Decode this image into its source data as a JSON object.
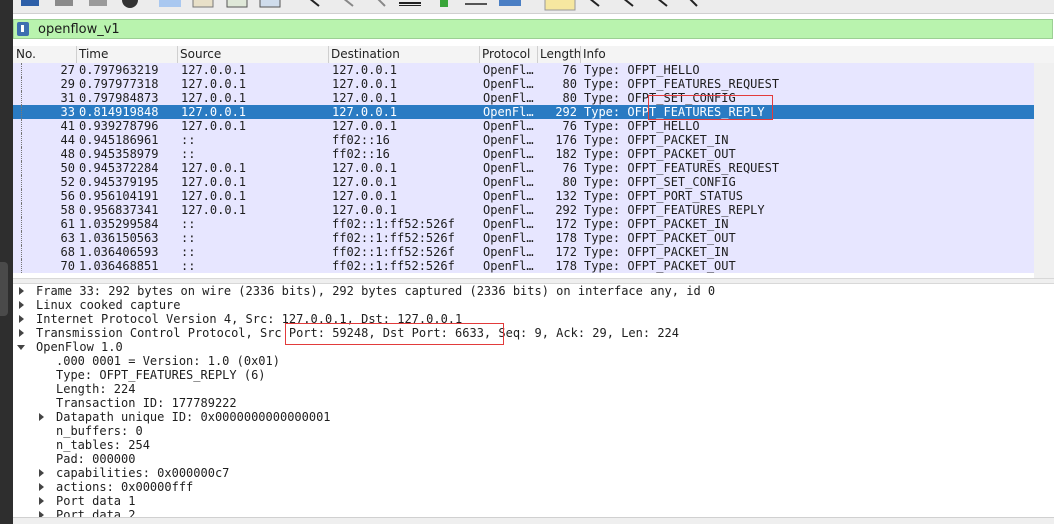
{
  "filter": {
    "value": "openflow_v1"
  },
  "columns": [
    "No.",
    "Time",
    "Source",
    "Destination",
    "Protocol",
    "Length",
    "Info"
  ],
  "packets": [
    {
      "no": "27",
      "time": "0.797963219",
      "src": "127.0.0.1",
      "dst": "127.0.0.1",
      "proto": "OpenFl…",
      "len": "76",
      "info": "Type: OFPT_HELLO"
    },
    {
      "no": "29",
      "time": "0.797977318",
      "src": "127.0.0.1",
      "dst": "127.0.0.1",
      "proto": "OpenFl…",
      "len": "80",
      "info": "Type: OFPT_FEATURES_REQUEST"
    },
    {
      "no": "31",
      "time": "0.797984873",
      "src": "127.0.0.1",
      "dst": "127.0.0.1",
      "proto": "OpenFl…",
      "len": "80",
      "info": "Type: OFPT_SET_CONFIG"
    },
    {
      "no": "33",
      "time": "0.814919848",
      "src": "127.0.0.1",
      "dst": "127.0.0.1",
      "proto": "OpenFl…",
      "len": "292",
      "info": "Type: OFPT_FEATURES_REPLY",
      "selected": true
    },
    {
      "no": "41",
      "time": "0.939278796",
      "src": "127.0.0.1",
      "dst": "127.0.0.1",
      "proto": "OpenFl…",
      "len": "76",
      "info": "Type: OFPT_HELLO"
    },
    {
      "no": "44",
      "time": "0.945186961",
      "src": "::",
      "dst": "ff02::16",
      "proto": "OpenFl…",
      "len": "176",
      "info": "Type: OFPT_PACKET_IN"
    },
    {
      "no": "48",
      "time": "0.945358979",
      "src": "::",
      "dst": "ff02::16",
      "proto": "OpenFl…",
      "len": "182",
      "info": "Type: OFPT_PACKET_OUT"
    },
    {
      "no": "50",
      "time": "0.945372284",
      "src": "127.0.0.1",
      "dst": "127.0.0.1",
      "proto": "OpenFl…",
      "len": "76",
      "info": "Type: OFPT_FEATURES_REQUEST"
    },
    {
      "no": "52",
      "time": "0.945379195",
      "src": "127.0.0.1",
      "dst": "127.0.0.1",
      "proto": "OpenFl…",
      "len": "80",
      "info": "Type: OFPT_SET_CONFIG"
    },
    {
      "no": "56",
      "time": "0.956104191",
      "src": "127.0.0.1",
      "dst": "127.0.0.1",
      "proto": "OpenFl…",
      "len": "132",
      "info": "Type: OFPT_PORT_STATUS"
    },
    {
      "no": "58",
      "time": "0.956837341",
      "src": "127.0.0.1",
      "dst": "127.0.0.1",
      "proto": "OpenFl…",
      "len": "292",
      "info": "Type: OFPT_FEATURES_REPLY"
    },
    {
      "no": "61",
      "time": "1.035299584",
      "src": "::",
      "dst": "ff02::1:ff52:526f",
      "proto": "OpenFl…",
      "len": "172",
      "info": "Type: OFPT_PACKET_IN"
    },
    {
      "no": "63",
      "time": "1.036150563",
      "src": "::",
      "dst": "ff02::1:ff52:526f",
      "proto": "OpenFl…",
      "len": "178",
      "info": "Type: OFPT_PACKET_OUT"
    },
    {
      "no": "68",
      "time": "1.036406593",
      "src": "::",
      "dst": "ff02::1:ff52:526f",
      "proto": "OpenFl…",
      "len": "172",
      "info": "Type: OFPT_PACKET_IN"
    },
    {
      "no": "70",
      "time": "1.036468851",
      "src": "::",
      "dst": "ff02::1:ff52:526f",
      "proto": "OpenFl…",
      "len": "178",
      "info": "Type: OFPT_PACKET_OUT"
    }
  ],
  "details": [
    {
      "text": "Frame 33: 292 bytes on wire (2336 bits), 292 bytes captured (2336 bits) on interface any, id 0",
      "arrow": "right",
      "indent": 0
    },
    {
      "text": "Linux cooked capture",
      "arrow": "right",
      "indent": 0
    },
    {
      "text": "Internet Protocol Version 4, Src: 127.0.0.1, Dst: 127.0.0.1",
      "arrow": "right",
      "indent": 0
    },
    {
      "text": "Transmission Control Protocol, Src Port: 59248, Dst Port: 6633, Seq: 9, Ack: 29, Len: 224",
      "arrow": "right",
      "indent": 0
    },
    {
      "text": "OpenFlow 1.0",
      "arrow": "down",
      "indent": 0
    },
    {
      "text": ".000 0001 = Version: 1.0 (0x01)",
      "arrow": "none",
      "indent": 1
    },
    {
      "text": "Type: OFPT_FEATURES_REPLY (6)",
      "arrow": "none",
      "indent": 1
    },
    {
      "text": "Length: 224",
      "arrow": "none",
      "indent": 1
    },
    {
      "text": "Transaction ID: 177789222",
      "arrow": "none",
      "indent": 1
    },
    {
      "text": "Datapath unique ID: 0x0000000000000001",
      "arrow": "right",
      "indent": 1
    },
    {
      "text": "n_buffers: 0",
      "arrow": "none",
      "indent": 1
    },
    {
      "text": "n_tables: 254",
      "arrow": "none",
      "indent": 1
    },
    {
      "text": "Pad: 000000",
      "arrow": "none",
      "indent": 1
    },
    {
      "text": "capabilities: 0x000000c7",
      "arrow": "right",
      "indent": 1
    },
    {
      "text": "actions: 0x00000fff",
      "arrow": "right",
      "indent": 1
    },
    {
      "text": "Port data 1",
      "arrow": "right",
      "indent": 1
    },
    {
      "text": "Port data 2",
      "arrow": "right",
      "indent": 1
    }
  ],
  "colors": {
    "row_bg": "#e7e6ff",
    "selected_bg": "#2a7bc3",
    "filter_bg": "#b9f3ae",
    "highlight_box": "#e23b3b"
  }
}
